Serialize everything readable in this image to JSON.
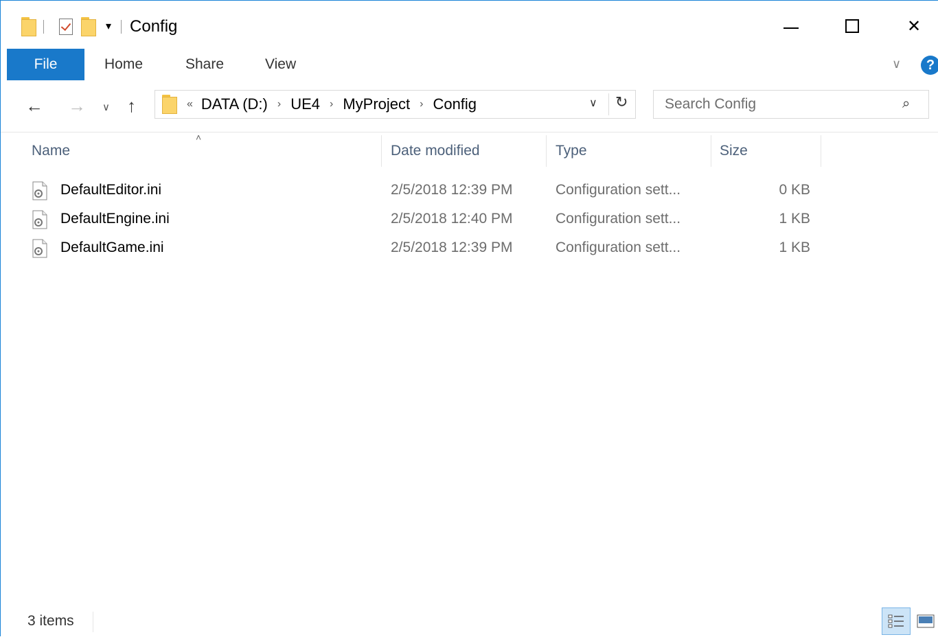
{
  "window": {
    "title": "Config",
    "qat_dropdown_glyph": "▾",
    "minimize_icon": "minimize-icon",
    "maximize_icon": "maximize-icon",
    "close_glyph": "✕"
  },
  "ribbon": {
    "tabs": [
      {
        "label": "File",
        "active": true
      },
      {
        "label": "Home"
      },
      {
        "label": "Share"
      },
      {
        "label": "View"
      }
    ],
    "expand_glyph": "∨",
    "help_glyph": "?"
  },
  "nav": {
    "back_glyph": "←",
    "forward_glyph": "→",
    "recent_glyph": "∨",
    "up_glyph": "↑"
  },
  "address": {
    "lead": "«",
    "crumbs": [
      "DATA (D:)",
      "UE4",
      "MyProject",
      "Config"
    ],
    "separator": "›",
    "dropdown_glyph": "∨",
    "refresh_glyph": "↻"
  },
  "search": {
    "placeholder": "Search Config",
    "icon_glyph": "⌕"
  },
  "columns": {
    "sort_glyph": "˄",
    "name": "Name",
    "date_modified": "Date modified",
    "type": "Type",
    "size": "Size"
  },
  "files": [
    {
      "name": "DefaultEditor.ini",
      "date": "2/5/2018 12:39 PM",
      "type": "Configuration sett...",
      "size": "0 KB"
    },
    {
      "name": "DefaultEngine.ini",
      "date": "2/5/2018 12:40 PM",
      "type": "Configuration sett...",
      "size": "1 KB"
    },
    {
      "name": "DefaultGame.ini",
      "date": "2/5/2018 12:39 PM",
      "type": "Configuration sett...",
      "size": "1 KB"
    }
  ],
  "status": {
    "item_count": "3 items"
  },
  "colors": {
    "accent": "#1979ca",
    "folder": "#fbd46a",
    "header_text": "#4c607a"
  }
}
